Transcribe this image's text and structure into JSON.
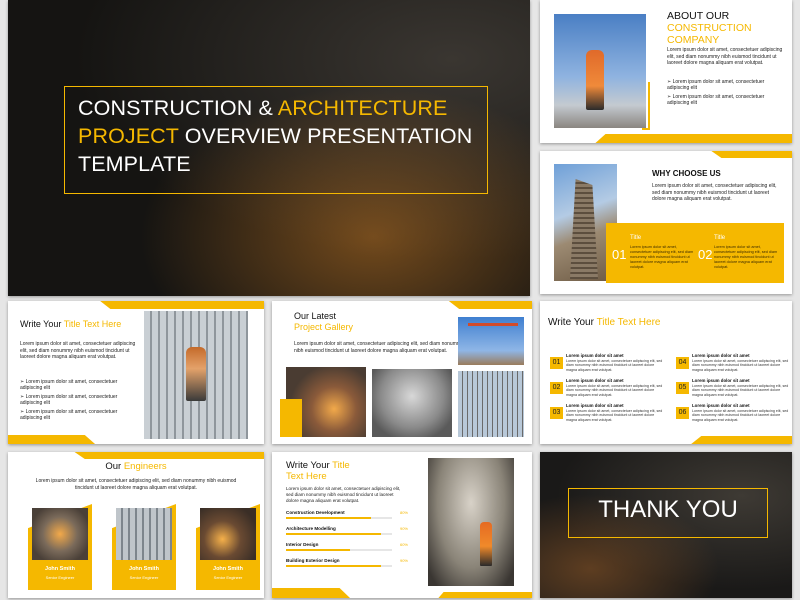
{
  "colors": {
    "accent": "#f5b800",
    "dark": "#1e1e1e",
    "text": "#222222"
  },
  "s1": {
    "line1a": "CONSTRUCTION & ",
    "line1b": "ARCHITECTURE",
    "line2a": "PROJECT",
    "line2b": " OVERVIEW PRESENTATION",
    "line3": "TEMPLATE"
  },
  "s2": {
    "title1": "ABOUT OUR",
    "title2": "CONSTRUCTION",
    "title3": "COMPANY",
    "body": "Lorem ipsum dolor sit amet, consectetuer adipiscing elit, sed diam nonummy nibh euismod tincidunt ut laoreet dolore magna aliquam erat volutpat.",
    "bullets": [
      "Lorem ipsum dolor sit amet, consectetuer adipiscing elit",
      "Lorem ipsum dolor sit amet, consectetuer adipiscing elit"
    ]
  },
  "s3": {
    "title": "WHY CHOOSE US",
    "body": "Lorem ipsum dolor sit amet, consectetuer adipiscing elit, sed diam nonummy nibh euismod tincidunt ut laoreet dolore magna aliquam erat volutpat.",
    "items": [
      {
        "num": "01",
        "title": "Title",
        "text": "Lorem ipsum dolor sit amet, consectetuer adipiscing elit, sed diam nonummy nibh euismod tincidunt ut laoreet dolore magna aliquam erat volutpat."
      },
      {
        "num": "02",
        "title": "Title",
        "text": "Lorem ipsum dolor sit amet, consectetuer adipiscing elit, sed diam nonummy nibh euismod tincidunt ut laoreet dolore magna aliquam erat volutpat."
      }
    ]
  },
  "s4": {
    "title_a": "Write Your ",
    "title_b": "Title Text Here",
    "body": "Lorem ipsum dolor sit amet, consectetuer adipiscing elit, sed diam nonummy nibh euismod tincidunt ut laoreet dolore magna aliquam erat volutpat.",
    "bullets": [
      "Lorem ipsum dolor sit amet, consectetuer adipiscing elit",
      "Lorem ipsum dolor sit amet, consectetuer adipiscing elit",
      "Lorem ipsum dolor sit amet, consectetuer adipiscing elit"
    ]
  },
  "s5": {
    "title1": "Our Latest",
    "title2": "Project Gallery",
    "body": "Lorem ipsum dolor sit amet, consectetuer adipiscing elit, sed diam nonummy nibh euismod tincidunt ut laoreet dolore magna aliquam erat volutpat."
  },
  "s6": {
    "title_a": "Write Your ",
    "title_b": "Title Text Here",
    "items": [
      {
        "num": "01",
        "title": "Lorem ipsum dolor sit amet",
        "text": "Lorem ipsum dolor sit amet, consectetuer adipiscing elit, sed diam nonummy nibh euismod tincidunt ut laoreet dolore magna aliquam erat volutpat."
      },
      {
        "num": "02",
        "title": "Lorem ipsum dolor sit amet",
        "text": "Lorem ipsum dolor sit amet, consectetuer adipiscing elit, sed diam nonummy nibh euismod tincidunt ut laoreet dolore magna aliquam erat volutpat."
      },
      {
        "num": "03",
        "title": "Lorem ipsum dolor sit amet",
        "text": "Lorem ipsum dolor sit amet, consectetuer adipiscing elit, sed diam nonummy nibh euismod tincidunt ut laoreet dolore magna aliquam erat volutpat."
      },
      {
        "num": "04",
        "title": "Lorem ipsum dolor sit amet",
        "text": "Lorem ipsum dolor sit amet, consectetuer adipiscing elit, sed diam nonummy nibh euismod tincidunt ut laoreet dolore magna aliquam erat volutpat."
      },
      {
        "num": "05",
        "title": "Lorem ipsum dolor sit amet",
        "text": "Lorem ipsum dolor sit amet, consectetuer adipiscing elit, sed diam nonummy nibh euismod tincidunt ut laoreet dolore magna aliquam erat volutpat."
      },
      {
        "num": "06",
        "title": "Lorem ipsum dolor sit amet",
        "text": "Lorem ipsum dolor sit amet, consectetuer adipiscing elit, sed diam nonummy nibh euismod tincidunt ut laoreet dolore magna aliquam erat volutpat."
      }
    ]
  },
  "s7": {
    "title_a": "Our ",
    "title_b": "Engineers",
    "body": "Lorem ipsum dolor sit amet, consectetuer adipiscing elit, sed diam nonummy nibh euismod tincidunt ut laoreet dolore magna aliquam erat volutpat.",
    "people": [
      {
        "name": "John Smith",
        "role": "Senior Engineer"
      },
      {
        "name": "John Smith",
        "role": "Senior Engineer"
      },
      {
        "name": "John Smith",
        "role": "Senior Engineer"
      }
    ]
  },
  "s8": {
    "title_a": "Write Your ",
    "title_b": "Title",
    "title_c": "Text Here",
    "body": "Lorem ipsum dolor sit amet, consectetuer adipiscing elit, sed diam nonummy nibh euismod tincidunt ut laoreet dolore magna aliquam erat volutpat.",
    "bars": [
      {
        "label": "Construction Development",
        "pct": "80%",
        "value": 80
      },
      {
        "label": "Architecture Modelling",
        "pct": "90%",
        "value": 90
      },
      {
        "label": "Interior Design",
        "pct": "60%",
        "value": 60
      },
      {
        "label": "Building Exterior Design",
        "pct": "90%",
        "value": 90
      }
    ]
  },
  "s9": {
    "text": "THANK YOU"
  }
}
